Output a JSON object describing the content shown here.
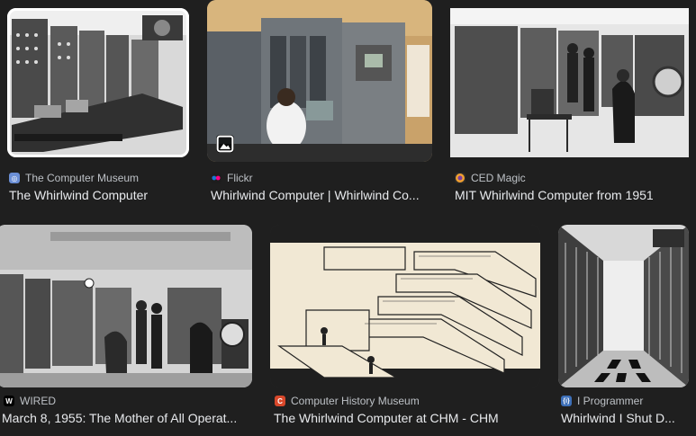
{
  "results": [
    {
      "source": "The Computer Museum",
      "title": "The Whirlwind Computer",
      "favicon_color": "#6b8fd6",
      "favicon_glyph": "◎",
      "selected": true
    },
    {
      "source": "Flickr",
      "title": "Whirlwind Computer | Whirlwind Co...",
      "favicon_color": "#1d1d1d",
      "favicon_glyph": "●●",
      "has_media_badge": true
    },
    {
      "source": "CED Magic",
      "title": "MIT Whirlwind Computer from 1951",
      "favicon_color": "#e08a2a",
      "favicon_glyph": "◉"
    },
    {
      "source": "WIRED",
      "title": "March 8, 1955: The Mother of All Operat...",
      "favicon_color": "#000000",
      "favicon_glyph": "W"
    },
    {
      "source": "Computer History Museum",
      "title": "The Whirlwind Computer at CHM - CHM",
      "favicon_color": "#d9482b",
      "favicon_glyph": "C"
    },
    {
      "source": "I Programmer",
      "title": "Whirlwind I Shut D...",
      "favicon_color": "#3d6fb8",
      "favicon_glyph": "{i}"
    }
  ]
}
